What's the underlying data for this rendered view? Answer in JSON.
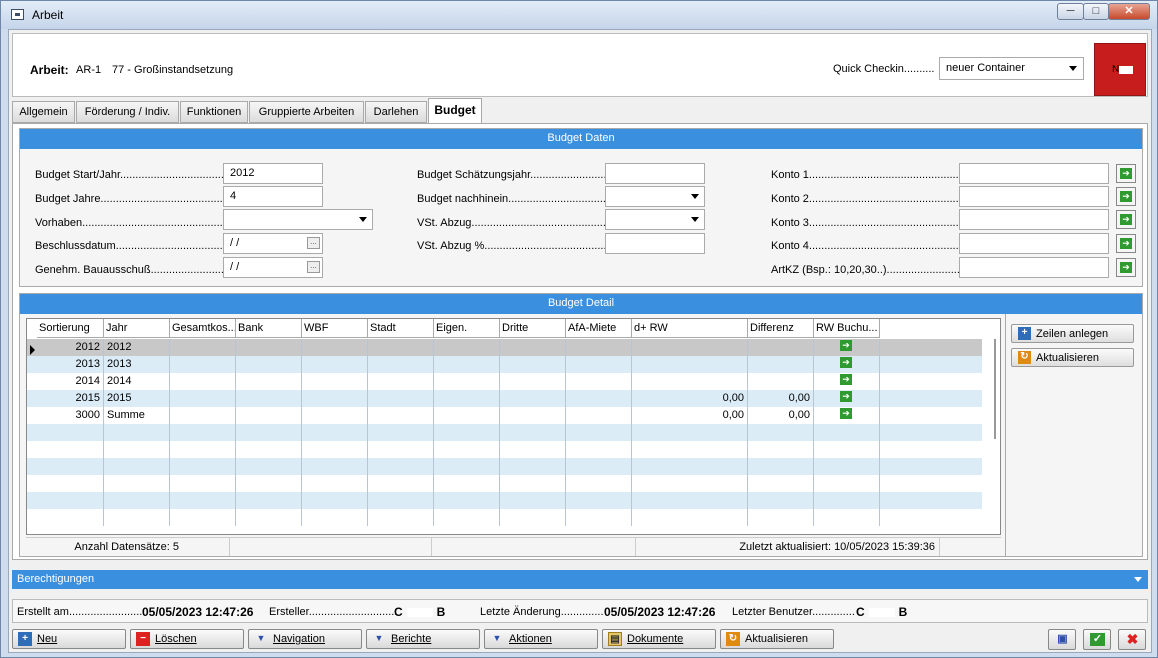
{
  "window": {
    "title": "Arbeit",
    "min": "─",
    "max": "□",
    "close": "✕"
  },
  "header": {
    "arbeit_label": "Arbeit:",
    "arbeit_id": "AR-1",
    "arbeit_name": "77 - Großinstandsetzung",
    "quick_checkin_label": "Quick Checkin..........",
    "quick_checkin_value": "neuer Container",
    "status_text": "N"
  },
  "tabs": [
    "Allgemein",
    "Förderung / Indiv.",
    "Funktionen",
    "Gruppierte Arbeiten",
    "Darlehen",
    "Budget"
  ],
  "budget_daten": {
    "title": "Budget Daten",
    "col1": {
      "start_label": "Budget Start/Jahr.............................................",
      "start_value": "2012",
      "jahre_label": "Budget Jahre.....................................................",
      "jahre_value": "4",
      "vorhaben_label": "Vorhaben.............................................................",
      "beschluss_label": "Beschlussdatum..................................................",
      "beschluss_value": " /  /",
      "genehm_label": "Genehm. Bauausschuß......................................",
      "genehm_value": " /  /"
    },
    "col2": {
      "schaetz_label": "Budget Schätzungsjahr.............................",
      "nachhinein_label": "Budget nachhinein......................................",
      "vst_label": "VSt. Abzug.....................................................",
      "vstp_label": "VSt. Abzug %................................................."
    },
    "col3": {
      "konto1": "Konto 1.................................................................",
      "konto2": "Konto 2.................................................................",
      "konto3": "Konto 3.................................................................",
      "konto4": "Konto 4.................................................................",
      "artkz": "ArtKZ (Bsp.: 10,20,30..)..........................................."
    },
    "go_icon": "➔",
    "dot_icon": "..."
  },
  "budget_detail": {
    "title": "Budget Detail",
    "columns": [
      "Sortierung",
      "Jahr",
      "Gesamtkos...",
      "Bank",
      "WBF",
      "Stadt",
      "Eigen.",
      "Dritte",
      "AfA-Miete",
      "d+ RW",
      "Differenz",
      "RW Buchu..."
    ],
    "rows": [
      {
        "sort": "2012",
        "jahr": "2012",
        "drw": "",
        "diff": ""
      },
      {
        "sort": "2013",
        "jahr": "2013",
        "drw": "",
        "diff": ""
      },
      {
        "sort": "2014",
        "jahr": "2014",
        "drw": "",
        "diff": ""
      },
      {
        "sort": "2015",
        "jahr": "2015",
        "drw": "0,00",
        "diff": "0,00"
      },
      {
        "sort": "3000",
        "jahr": "Summe",
        "drw": "0,00",
        "diff": "0,00"
      }
    ],
    "status_count": "Anzahl Datensätze: 5",
    "status_updated": "Zuletzt aktualisiert: 10/05/2023 15:39:36",
    "side_buttons": {
      "zeilen": "Zeilen anlegen",
      "aktualisieren": "Aktualisieren"
    }
  },
  "berechtigungen": "Berechtigungen",
  "audit": {
    "erstellt_label": "Erstellt am.........................",
    "erstellt_value": "05/05/2023 12:47:26",
    "ersteller_label": "Ersteller.............................",
    "ersteller_a": "C",
    "ersteller_b": "B",
    "letzte_label": "Letzte Änderung..............",
    "letzte_value": "05/05/2023 12:47:26",
    "benutzer_label": "Letzter Benutzer..............",
    "benutzer_a": "C",
    "benutzer_b": "B"
  },
  "footer": {
    "neu": "Neu",
    "loeschen": "Löschen",
    "navigation": "Navigation",
    "berichte": "Berichte",
    "aktionen": "Aktionen",
    "dokumente": "Dokumente",
    "aktualisieren": "Aktualisieren"
  },
  "colors": {
    "accent": "#3a8fde",
    "status_red": "#c81d1d",
    "go_green": "#2f9a2f",
    "row_alt": "#dcecf7"
  }
}
